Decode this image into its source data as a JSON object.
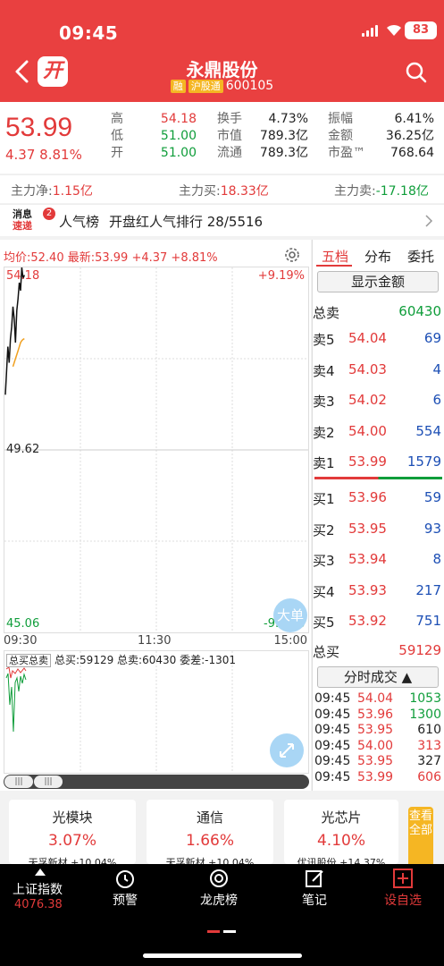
{
  "status": {
    "time": "09:45",
    "battery": "83"
  },
  "header": {
    "title": "永鼎股份",
    "tag_rong": "融",
    "tag_hgt": "沪股通",
    "code": "600105",
    "kai_label": "开"
  },
  "quote": {
    "price": "53.99",
    "change": "4.37 8.81%",
    "col1": [
      {
        "label": "高",
        "value": "54.18"
      },
      {
        "label": "低",
        "value": "51.00"
      },
      {
        "label": "开",
        "value": "51.00"
      }
    ],
    "col2": [
      {
        "label": "换手",
        "value": "4.73%"
      },
      {
        "label": "市值",
        "value": "789.3亿"
      },
      {
        "label": "流通",
        "value": "789.3亿"
      }
    ],
    "col3": [
      {
        "label": "振幅",
        "value": "6.41%"
      },
      {
        "label": "金额",
        "value": "36.25亿"
      },
      {
        "label": "市盈™",
        "value": "768.64"
      }
    ]
  },
  "flow": {
    "net_label": "主力净:",
    "net": "1.15亿",
    "buy_label": "主力买:",
    "buy": "18.33亿",
    "sell_label": "主力卖:",
    "sell": "-17.18亿"
  },
  "news": {
    "logo_top": "消息",
    "logo_bottom": "速递",
    "badge": "2",
    "tag": "人气榜",
    "text": "开盘红人气排行 28/5516"
  },
  "chart": {
    "info": "均价:52.40 最新:53.99 +4.37 +8.81%",
    "y_top": "54.18",
    "y_mid": "49.62",
    "y_bot": "45.06",
    "pct_top": "+9.19%",
    "pct_bot": "-9.19%",
    "times": [
      "09:30",
      "11:30",
      "15:00"
    ],
    "daban_label": "大单",
    "sub_select": "总买总卖",
    "sub_buy": "总买:59129",
    "sub_sell": "总卖:60430",
    "sub_diff": "委差:-1301"
  },
  "chart_data": {
    "type": "line",
    "title": "",
    "ylim": [
      45.06,
      54.18
    ],
    "x": [
      "09:30",
      "09:31",
      "09:32",
      "09:33",
      "09:34",
      "09:35",
      "09:36",
      "09:37",
      "09:38",
      "09:39",
      "09:40",
      "09:41",
      "09:42",
      "09:43",
      "09:44",
      "09:45"
    ],
    "series": [
      {
        "name": "最新",
        "values": [
          51.0,
          51.6,
          52.2,
          51.8,
          52.4,
          52.7,
          53.2,
          52.9,
          52.3,
          53.1,
          53.4,
          53.8,
          53.6,
          54.18,
          53.9,
          53.99
        ]
      },
      {
        "name": "均价",
        "values": [
          null,
          null,
          null,
          null,
          null,
          null,
          51.7,
          51.8,
          51.9,
          52.0,
          52.1,
          52.2,
          52.3,
          52.35,
          52.38,
          52.4
        ]
      }
    ]
  },
  "book": {
    "tabs": [
      "五档",
      "分布",
      "委托"
    ],
    "show_amount": "显示金额",
    "total_sell_label": "总卖",
    "total_sell": "60430",
    "asks": [
      {
        "label": "卖5",
        "price": "54.04",
        "vol": "69"
      },
      {
        "label": "卖4",
        "price": "54.03",
        "vol": "4"
      },
      {
        "label": "卖3",
        "price": "54.02",
        "vol": "6"
      },
      {
        "label": "卖2",
        "price": "54.00",
        "vol": "554"
      },
      {
        "label": "卖1",
        "price": "53.99",
        "vol": "1579"
      }
    ],
    "bids": [
      {
        "label": "买1",
        "price": "53.96",
        "vol": "59"
      },
      {
        "label": "买2",
        "price": "53.95",
        "vol": "93"
      },
      {
        "label": "买3",
        "price": "53.94",
        "vol": "8"
      },
      {
        "label": "买4",
        "price": "53.93",
        "vol": "217"
      },
      {
        "label": "买5",
        "price": "53.92",
        "vol": "751"
      }
    ],
    "total_buy_label": "总买",
    "total_buy": "59129",
    "ticks_label": "分时成交 ▲",
    "ticks": [
      {
        "time": "09:45",
        "price": "54.04",
        "vol": "1053",
        "color": "green"
      },
      {
        "time": "09:45",
        "price": "53.96",
        "vol": "1300",
        "color": "green"
      },
      {
        "time": "09:45",
        "price": "53.95",
        "vol": "610",
        "color": "black"
      },
      {
        "time": "09:45",
        "price": "54.00",
        "vol": "313",
        "color": "red"
      },
      {
        "time": "09:45",
        "price": "53.95",
        "vol": "327",
        "color": "black"
      },
      {
        "time": "09:45",
        "price": "53.99",
        "vol": "606",
        "color": "red"
      }
    ]
  },
  "cards": [
    {
      "name": "光模块",
      "pct": "3.07%",
      "sub": "天孚新材 +10.04%"
    },
    {
      "name": "通信",
      "pct": "1.66%",
      "sub": "天孚新材 +10.04%"
    },
    {
      "name": "光芯片",
      "pct": "4.10%",
      "sub": "优讯股份 +14.37%"
    }
  ],
  "view_all": "查看全部",
  "nav": {
    "index_name": "上证指数",
    "index_value": "4076.38",
    "items": [
      "预警",
      "龙虎榜",
      "笔记",
      "设自选"
    ]
  }
}
